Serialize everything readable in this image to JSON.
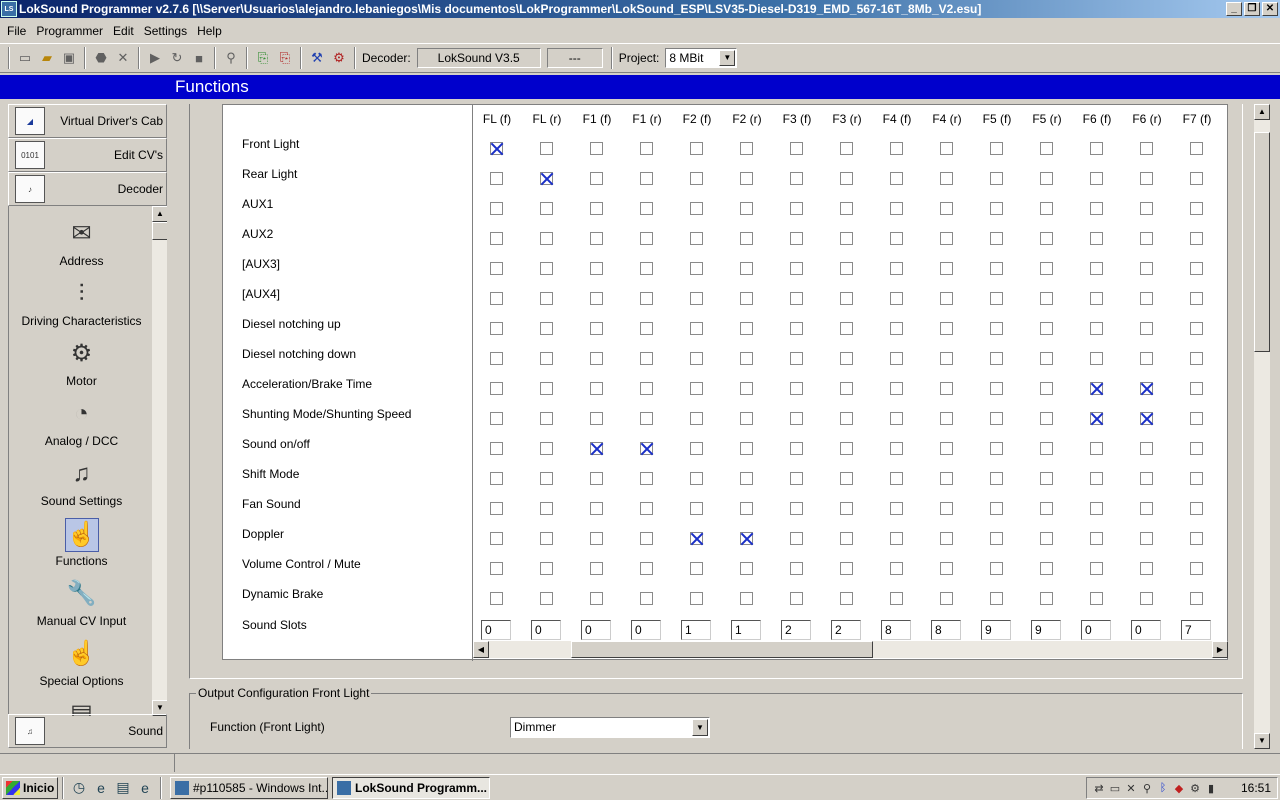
{
  "window": {
    "title": "LokSound Programmer  v2.7.6  [\\\\Server\\Usuarios\\alejandro.lebaniegos\\Mis documentos\\LokProgrammer\\LokSound_ESP\\LSV35-Diesel-D319_EMD_567-16T_8Mb_V2.esu]",
    "minimize": "_",
    "restore": "❐",
    "close": "✕"
  },
  "menu": [
    "File",
    "Programmer",
    "Edit",
    "Settings",
    "Help"
  ],
  "toolbar": {
    "decoder_label": "Decoder:",
    "decoder_value": "LokSound V3.5",
    "decoder_extra": "---",
    "project_label": "Project:",
    "project_value": "8 MBit",
    "icons": [
      "new-icon",
      "open-icon",
      "save-icon",
      "stop-icon",
      "cancel-icon",
      "play-icon",
      "redo-icon",
      "record-icon",
      "pin-icon",
      "read-icon",
      "write-icon",
      "tools-icon",
      "settings-icon"
    ]
  },
  "header": {
    "title": "Functions"
  },
  "sidebar": {
    "top_items": [
      {
        "label": "Virtual Driver's Cab",
        "icon": "cab-icon"
      },
      {
        "label": "Edit CV's",
        "icon": "binary-icon"
      },
      {
        "label": "Decoder",
        "icon": "decoder-icon"
      }
    ],
    "sub_items": [
      {
        "label": "Address",
        "icon": "envelope-icon",
        "glyph": "✉"
      },
      {
        "label": "Driving Characteristics",
        "icon": "sliders-icon",
        "glyph": "⫶"
      },
      {
        "label": "Motor",
        "icon": "motor-icon",
        "glyph": "⚙"
      },
      {
        "label": "Analog / DCC",
        "icon": "meter-icon",
        "glyph": "◔"
      },
      {
        "label": "Sound Settings",
        "icon": "music-icon",
        "glyph": "♫"
      },
      {
        "label": "Functions",
        "icon": "functions-icon",
        "glyph": "☝",
        "selected": true
      },
      {
        "label": "Manual CV Input",
        "icon": "wrench-icon",
        "glyph": "🔧"
      },
      {
        "label": "Special Options",
        "icon": "special-icon",
        "glyph": "☝"
      },
      {
        "label": "",
        "icon": "card-icon",
        "glyph": "▤"
      }
    ],
    "bottom_item": {
      "label": "Sound",
      "icon": "sound-icon"
    }
  },
  "functions": {
    "columns": [
      "FL (f)",
      "FL (r)",
      "F1 (f)",
      "F1 (r)",
      "F2 (f)",
      "F2 (r)",
      "F3 (f)",
      "F3 (r)",
      "F4 (f)",
      "F4 (r)",
      "F5 (f)",
      "F5 (r)",
      "F6 (f)",
      "F6 (r)",
      "F7 (f)"
    ],
    "rows": [
      {
        "label": "Front Light",
        "checked": [
          0
        ]
      },
      {
        "label": "Rear Light",
        "checked": [
          1
        ]
      },
      {
        "label": "AUX1",
        "checked": []
      },
      {
        "label": "AUX2",
        "checked": []
      },
      {
        "label": "[AUX3]",
        "checked": []
      },
      {
        "label": "[AUX4]",
        "checked": []
      },
      {
        "label": "Diesel notching up",
        "checked": []
      },
      {
        "label": "Diesel notching down",
        "checked": []
      },
      {
        "label": "Acceleration/Brake Time",
        "checked": [
          12,
          13
        ]
      },
      {
        "label": "Shunting Mode/Shunting Speed",
        "checked": [
          12,
          13
        ]
      },
      {
        "label": "Sound on/off",
        "checked": [
          2,
          3
        ]
      },
      {
        "label": "Shift Mode",
        "checked": []
      },
      {
        "label": "Fan Sound",
        "checked": []
      },
      {
        "label": "Doppler",
        "checked": [
          4,
          5
        ]
      },
      {
        "label": "Volume Control / Mute",
        "checked": []
      },
      {
        "label": "Dynamic Brake",
        "checked": []
      }
    ],
    "sound_slots_label": "Sound Slots",
    "sound_slots": [
      "0",
      "0",
      "0",
      "0",
      "1",
      "1",
      "2",
      "2",
      "8",
      "8",
      "9",
      "9",
      "0",
      "0",
      "7"
    ]
  },
  "output_config": {
    "legend": "Output Configuration Front Light",
    "function_label": "Function (Front Light)",
    "function_value": "Dimmer"
  },
  "taskbar": {
    "start_label": "Inicio",
    "quick_launch": [
      "clock-icon",
      "ie-icon",
      "document-icon",
      "ie-icon"
    ],
    "tasks": [
      {
        "label": "#p110585 - Windows Int...",
        "active": false
      },
      {
        "label": "LokSound Programm...",
        "active": true
      }
    ],
    "tray_icons": [
      "network-icon",
      "monitor-icon",
      "volume-icon",
      "search-icon",
      "bluetooth-icon",
      "shield-icon",
      "settings-icon",
      "device-icon"
    ],
    "clock": "16:51"
  }
}
